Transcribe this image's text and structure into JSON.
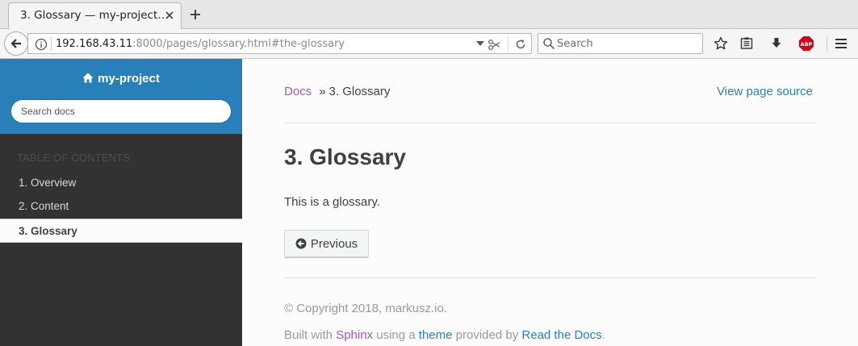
{
  "browser": {
    "tab_title": "3. Glossary — my-project…",
    "url_host": "192.168.43.11",
    "url_rest": ":8000/pages/glossary.html#the-glossary",
    "search_placeholder": "Search"
  },
  "sidebar": {
    "project_name": "my-project",
    "search_placeholder": "Search docs",
    "toc_caption": "TABLE OF CONTENTS",
    "items": [
      {
        "label": "1. Overview",
        "current": false
      },
      {
        "label": "2. Content",
        "current": false
      },
      {
        "label": "3. Glossary",
        "current": true
      }
    ]
  },
  "breadcrumb": {
    "root": "Docs",
    "separator": "»",
    "current": "3. Glossary",
    "view_source": "View page source"
  },
  "main": {
    "title": "3. Glossary",
    "text": "This is a glossary.",
    "previous_label": "Previous"
  },
  "footer": {
    "copyright": "© Copyright 2018, markusz.io.",
    "built_prefix": "Built with",
    "sphinx": "Sphinx",
    "using_a": "using a",
    "theme": "theme",
    "provided_by": "provided by",
    "rtd": "Read the Docs",
    "period": "."
  },
  "colors": {
    "sidebar_top": "#2980b9",
    "sidebar_bg": "#343131",
    "link_purple": "#9b59b6",
    "link_blue": "#2980b9"
  }
}
